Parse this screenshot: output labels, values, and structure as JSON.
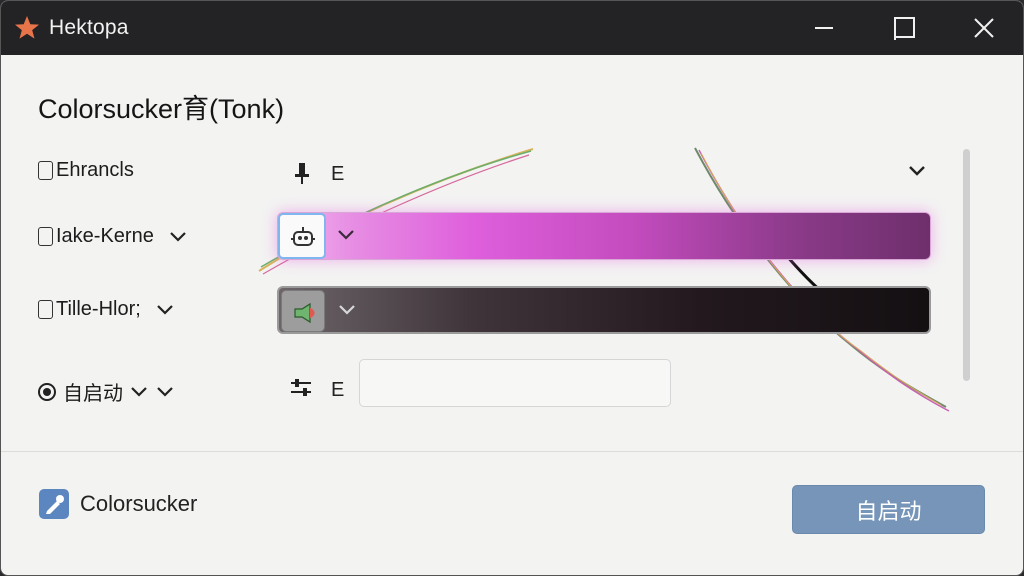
{
  "window": {
    "title": "Hektopa",
    "app_icon": "star-icon",
    "controls": [
      "minimize-icon",
      "maximize-icon",
      "close-icon"
    ]
  },
  "heading": "Colorsucker育(Tonk)",
  "rows": [
    {
      "label": "Ehrancls",
      "control": "checkbox",
      "value": "E",
      "icon": "pin-icon"
    },
    {
      "label": "Iake-Kerne",
      "control": "checkbox",
      "swatch_icon": "robot-icon"
    },
    {
      "label": "Tille-Hlor;",
      "control": "checkbox",
      "swatch_icon": "megaphone-icon"
    },
    {
      "label": "自启动",
      "control": "radio",
      "value": "E",
      "icon": "sliders-icon"
    }
  ],
  "footer": {
    "app_label": "Colorsucker",
    "app_icon": "eyedropper-icon",
    "button_label": "自启动"
  },
  "colors": {
    "titlebar": "#232325",
    "accent_button": "#7695b9",
    "swatch_pink": "#df5fdc",
    "swatch_dark": "#141012"
  }
}
